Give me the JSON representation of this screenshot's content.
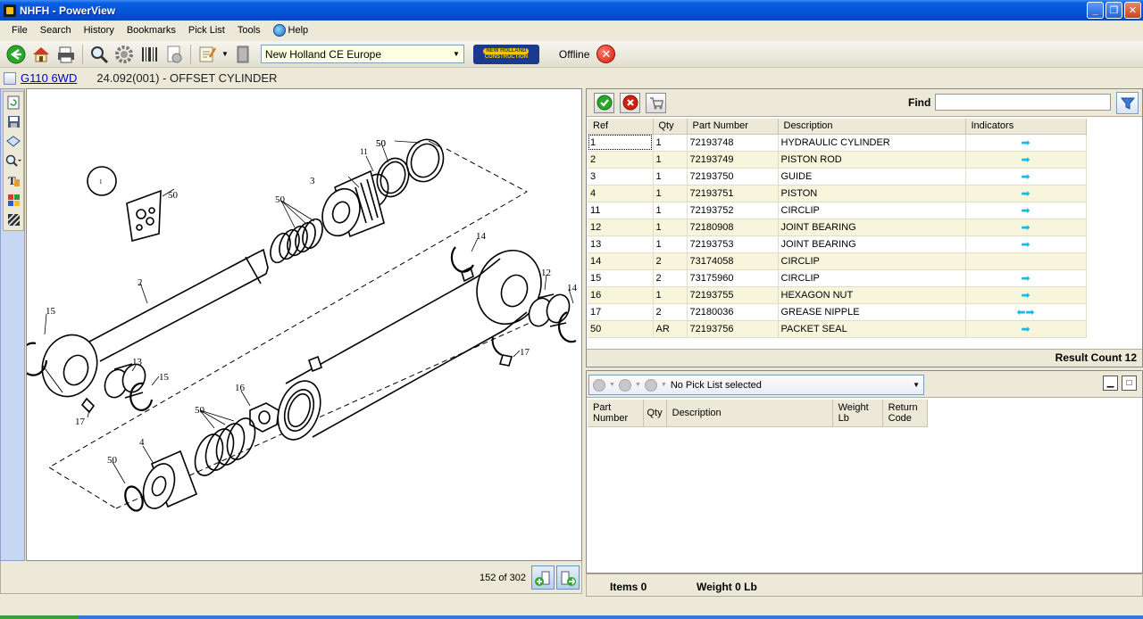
{
  "window": {
    "title": "NHFH - PowerView"
  },
  "menu": [
    "File",
    "Search",
    "History",
    "Bookmarks",
    "Pick List",
    "Tools",
    "Help"
  ],
  "toolbar": {
    "dealer": "New Holland CE Europe",
    "status": "Offline",
    "brand_top": "NEW HOLLAND",
    "brand_bottom": "CONSTRUCTION"
  },
  "breadcrumb": {
    "model": "G110 6WD",
    "section": "24.092(001) - OFFSET CYLINDER"
  },
  "diagram": {
    "page_info": "152 of 302",
    "callouts": [
      "1",
      "50",
      "50",
      "11",
      "50",
      "3",
      "50",
      "2",
      "14",
      "12",
      "14",
      "15",
      "13",
      "15",
      "17",
      "17",
      "16",
      "50",
      "4",
      "50"
    ]
  },
  "parts": {
    "find_label": "Find",
    "columns": [
      "Ref",
      "Qty",
      "Part Number",
      "Description",
      "Indicators"
    ],
    "rows": [
      {
        "ref": "1",
        "qty": "1",
        "part": "72193748",
        "desc": "HYDRAULIC CYLINDER",
        "ind": "➡"
      },
      {
        "ref": "2",
        "qty": "1",
        "part": "72193749",
        "desc": "PISTON ROD",
        "ind": "➡"
      },
      {
        "ref": "3",
        "qty": "1",
        "part": "72193750",
        "desc": "GUIDE",
        "ind": "➡"
      },
      {
        "ref": "4",
        "qty": "1",
        "part": "72193751",
        "desc": "PISTON",
        "ind": "➡"
      },
      {
        "ref": "11",
        "qty": "1",
        "part": "72193752",
        "desc": "CIRCLIP",
        "ind": "➡"
      },
      {
        "ref": "12",
        "qty": "1",
        "part": "72180908",
        "desc": "JOINT BEARING",
        "ind": "➡"
      },
      {
        "ref": "13",
        "qty": "1",
        "part": "72193753",
        "desc": "JOINT BEARING",
        "ind": "➡"
      },
      {
        "ref": "14",
        "qty": "2",
        "part": "73174058",
        "desc": "CIRCLIP",
        "ind": ""
      },
      {
        "ref": "15",
        "qty": "2",
        "part": "73175960",
        "desc": "CIRCLIP",
        "ind": "➡"
      },
      {
        "ref": "16",
        "qty": "1",
        "part": "72193755",
        "desc": "HEXAGON NUT",
        "ind": "➡"
      },
      {
        "ref": "17",
        "qty": "2",
        "part": "72180036",
        "desc": "GREASE NIPPLE",
        "ind": "⬅➡"
      },
      {
        "ref": "50",
        "qty": "AR",
        "part": "72193756",
        "desc": "PACKET SEAL",
        "ind": "➡"
      }
    ],
    "result_count": "Result Count 12"
  },
  "picklist": {
    "selected": "No Pick List selected",
    "columns": [
      "Part\nNumber",
      "Qty",
      "Description",
      "Weight\nLb",
      "Return\nCode"
    ],
    "items_label": "Items 0",
    "weight_label": "Weight 0 Lb"
  },
  "colors": {
    "indicator": "#16b9e8",
    "row_alt": "#f7f5dc",
    "titlebar": "#0453d8"
  }
}
